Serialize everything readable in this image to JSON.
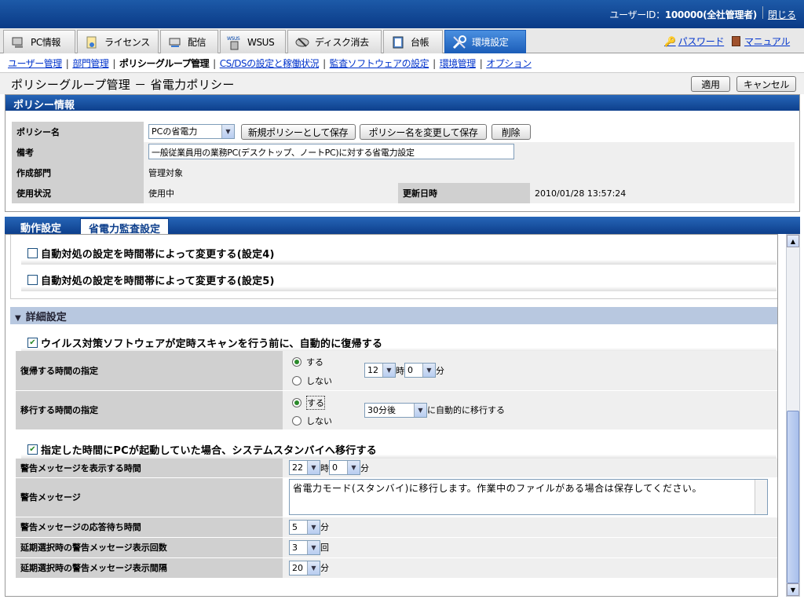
{
  "topbar": {
    "user_label": "ユーザーID：",
    "user_value": "100000(全社管理者)",
    "logout": "閉じる"
  },
  "tabs": [
    {
      "label": "PC情報",
      "icon": "pc-icon"
    },
    {
      "label": "ライセンス",
      "icon": "license-icon"
    },
    {
      "label": "配信",
      "icon": "delivery-icon"
    },
    {
      "label": "WSUS",
      "icon": "wsus-icon"
    },
    {
      "label": "ディスク消去",
      "icon": "disk-erase-icon"
    },
    {
      "label": "台帳",
      "icon": "ledger-icon"
    },
    {
      "label": "環境設定",
      "icon": "settings-icon",
      "active": true
    }
  ],
  "toplinks": {
    "password": "パスワード",
    "manual": "マニュアル"
  },
  "subnav": {
    "items": [
      "ユーザー管理",
      "部門管理",
      "ポリシーグループ管理",
      "CS/DSの設定と稼働状況",
      "監査ソフトウェアの設定",
      "環境管理",
      "オプション"
    ],
    "current": 2
  },
  "page": {
    "title": "ポリシーグループ管理 － 省電力ポリシー",
    "apply": "適用",
    "cancel": "キャンセル"
  },
  "policy": {
    "header": "ポリシー情報",
    "name_label": "ポリシー名",
    "name_value": "PCの省電力",
    "save_new": "新規ポリシーとして保存",
    "rename_save": "ポリシー名を変更して保存",
    "delete": "削除",
    "note_label": "備考",
    "note_value": "一般従業員用の業務PC(デスクトップ、ノートPC)に対する省電力設定",
    "dept_label": "作成部門",
    "dept_value": "管理対象",
    "status_label": "使用状況",
    "status_value": "使用中",
    "updated_label": "更新日時",
    "updated_value": "2010/01/28 13:57:24"
  },
  "subtabs": [
    "動作設定",
    "省電力監査設定"
  ],
  "settings": {
    "setting4": "自動対処の設定を時間帯によって変更する(設定4)",
    "setting5": "自動対処の設定を時間帯によって変更する(設定5)",
    "detail_header": "詳細設定",
    "virus_chk": "ウイルス対策ソフトウェアが定時スキャンを行う前に、自動的に復帰する",
    "resume_time_label": "復帰する時間の指定",
    "yes": "する",
    "no": "しない",
    "resume_hour": "12",
    "hour_unit": "時",
    "resume_min": "0",
    "min_unit": "分",
    "transition_label": "移行する時間の指定",
    "transition_value": "30分後",
    "transition_suffix": "に自動的に移行する",
    "standby_chk": "指定した時間にPCが起動していた場合、システムスタンバイへ移行する",
    "warn_time_label": "警告メッセージを表示する時間",
    "warn_hour": "22",
    "warn_min": "0",
    "warn_msg_label": "警告メッセージ",
    "warn_msg": "省電力モード(スタンバイ)に移行します。作業中のファイルがある場合は保存してください。",
    "wait_label": "警告メッセージの応答待ち時間",
    "wait_value": "5",
    "count_label": "延期選択時の警告メッセージ表示回数",
    "count_value": "3",
    "count_unit": "回",
    "interval_label": "延期選択時の警告メッセージ表示間隔",
    "interval_value": "20"
  }
}
